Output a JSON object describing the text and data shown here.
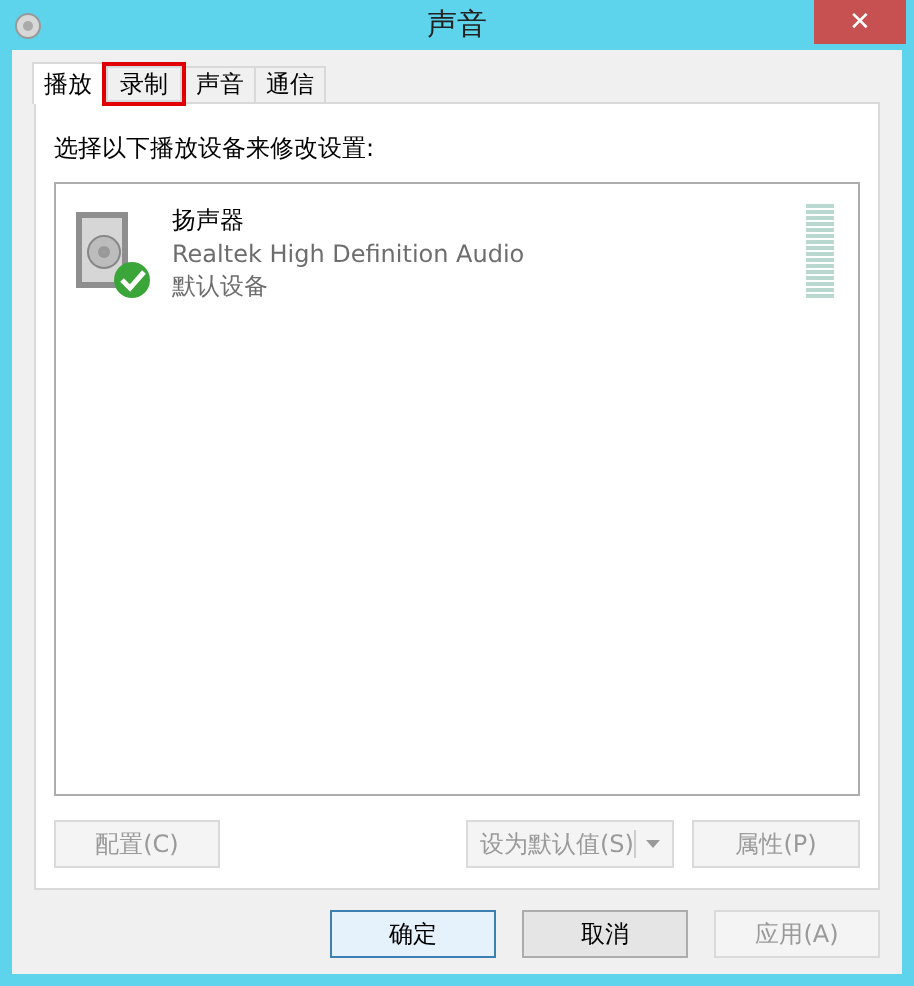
{
  "window": {
    "title": "声音",
    "close": "✕"
  },
  "tabs": [
    {
      "label": "播放",
      "selected": true,
      "highlighted": false
    },
    {
      "label": "录制",
      "selected": false,
      "highlighted": true
    },
    {
      "label": "声音",
      "selected": false,
      "highlighted": false
    },
    {
      "label": "通信",
      "selected": false,
      "highlighted": false
    }
  ],
  "instruction": "选择以下播放设备来修改设置:",
  "devices": [
    {
      "name": "扬声器",
      "driver": "Realtek High Definition Audio",
      "status": "默认设备",
      "default": true,
      "selected": false
    }
  ],
  "device_buttons": [
    {
      "label": "配置(C)",
      "disabled": true,
      "kind": "plain"
    },
    {
      "label": "设为默认值(S)",
      "disabled": true,
      "kind": "split"
    },
    {
      "label": "属性(P)",
      "disabled": true,
      "kind": "plain"
    }
  ],
  "dialog_buttons": [
    {
      "label": "确定",
      "disabled": false,
      "default": true
    },
    {
      "label": "取消",
      "disabled": false,
      "default": false
    },
    {
      "label": "应用(A)",
      "disabled": true,
      "default": false
    }
  ]
}
